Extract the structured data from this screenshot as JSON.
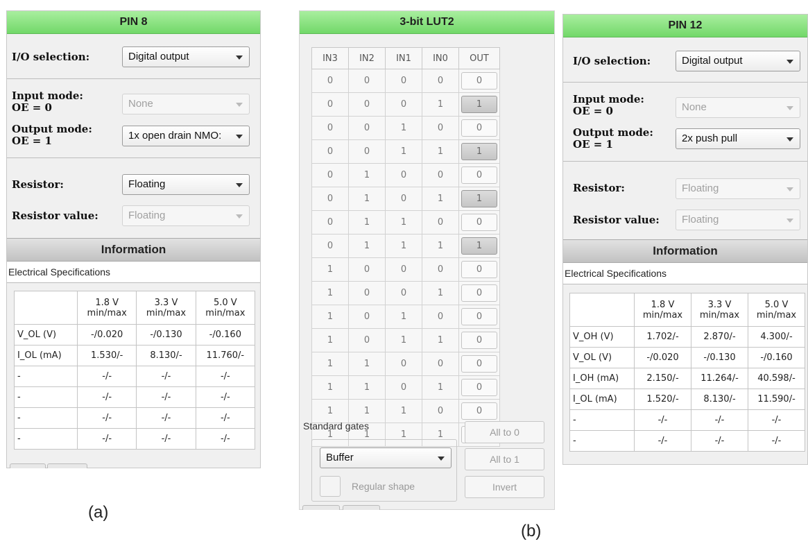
{
  "pin8": {
    "title": "PIN 8",
    "io_selection_label": "I/O selection:",
    "io_selection_value": "Digital output",
    "input_mode_label_line1": "Input mode:",
    "input_mode_label_line2": "OE = 0",
    "input_mode_value": "None",
    "output_mode_label_line1": "Output mode:",
    "output_mode_label_line2": "OE = 1",
    "output_mode_value": "1x open drain NMO:",
    "resistor_label": "Resistor:",
    "resistor_value": "Floating",
    "resistor_value_label": "Resistor value:",
    "resistor_value_value": "Floating",
    "info_title": "Information",
    "espec_label": "Electrical Specifications",
    "table": {
      "headers": [
        "1.8 V min/max",
        "3.3 V min/max",
        "5.0 V min/max"
      ],
      "rows": [
        {
          "label": "V_OL (V)",
          "cells": [
            "-/0.020",
            "-/0.130",
            "-/0.160"
          ]
        },
        {
          "label": "I_OL (mA)",
          "cells": [
            "1.530/-",
            "8.130/-",
            "11.760/-"
          ]
        },
        {
          "label": "-",
          "cells": [
            "-/-",
            "-/-",
            "-/-"
          ]
        },
        {
          "label": "-",
          "cells": [
            "-/-",
            "-/-",
            "-/-"
          ]
        },
        {
          "label": "-",
          "cells": [
            "-/-",
            "-/-",
            "-/-"
          ]
        },
        {
          "label": "-",
          "cells": [
            "-/-",
            "-/-",
            "-/-"
          ]
        }
      ]
    }
  },
  "lut": {
    "title": "3-bit LUT2",
    "columns": [
      "IN3",
      "IN2",
      "IN1",
      "IN0",
      "OUT"
    ],
    "rows": [
      [
        "0",
        "0",
        "0",
        "0",
        "0"
      ],
      [
        "0",
        "0",
        "0",
        "1",
        "1"
      ],
      [
        "0",
        "0",
        "1",
        "0",
        "0"
      ],
      [
        "0",
        "0",
        "1",
        "1",
        "1"
      ],
      [
        "0",
        "1",
        "0",
        "0",
        "0"
      ],
      [
        "0",
        "1",
        "0",
        "1",
        "1"
      ],
      [
        "0",
        "1",
        "1",
        "0",
        "0"
      ],
      [
        "0",
        "1",
        "1",
        "1",
        "1"
      ],
      [
        "1",
        "0",
        "0",
        "0",
        "0"
      ],
      [
        "1",
        "0",
        "0",
        "1",
        "0"
      ],
      [
        "1",
        "0",
        "1",
        "0",
        "0"
      ],
      [
        "1",
        "0",
        "1",
        "1",
        "0"
      ],
      [
        "1",
        "1",
        "0",
        "0",
        "0"
      ],
      [
        "1",
        "1",
        "0",
        "1",
        "0"
      ],
      [
        "1",
        "1",
        "1",
        "0",
        "0"
      ],
      [
        "1",
        "1",
        "1",
        "1",
        "0"
      ]
    ],
    "standard_gates_label": "Standard gates",
    "gate_value": "Buffer",
    "regular_shape_label": "Regular shape",
    "all_to_0": "All to 0",
    "all_to_1": "All to 1",
    "invert": "Invert"
  },
  "pin12": {
    "title": "PIN 12",
    "io_selection_label": "I/O selection:",
    "io_selection_value": "Digital output",
    "input_mode_label_line1": "Input mode:",
    "input_mode_label_line2": "OE = 0",
    "input_mode_value": "None",
    "output_mode_label_line1": "Output mode:",
    "output_mode_label_line2": "OE = 1",
    "output_mode_value": "2x push pull",
    "resistor_label": "Resistor:",
    "resistor_value": "Floating",
    "resistor_value_label": "Resistor value:",
    "resistor_value_value": "Floating",
    "info_title": "Information",
    "espec_label": "Electrical Specifications",
    "table": {
      "headers": [
        "1.8 V min/max",
        "3.3 V min/max",
        "5.0 V min/max"
      ],
      "rows": [
        {
          "label": "V_OH (V)",
          "cells": [
            "1.702/-",
            "2.870/-",
            "4.300/-"
          ]
        },
        {
          "label": "V_OL (V)",
          "cells": [
            "-/0.020",
            "-/0.130",
            "-/0.160"
          ]
        },
        {
          "label": "I_OH (mA)",
          "cells": [
            "2.150/-",
            "11.264/-",
            "40.598/-"
          ]
        },
        {
          "label": "I_OL (mA)",
          "cells": [
            "1.520/-",
            "8.130/-",
            "11.590/-"
          ]
        },
        {
          "label": "-",
          "cells": [
            "-/-",
            "-/-",
            "-/-"
          ]
        },
        {
          "label": "-",
          "cells": [
            "-/-",
            "-/-",
            "-/-"
          ]
        }
      ]
    }
  },
  "captions": {
    "a": "(a)",
    "b": "(b)"
  }
}
